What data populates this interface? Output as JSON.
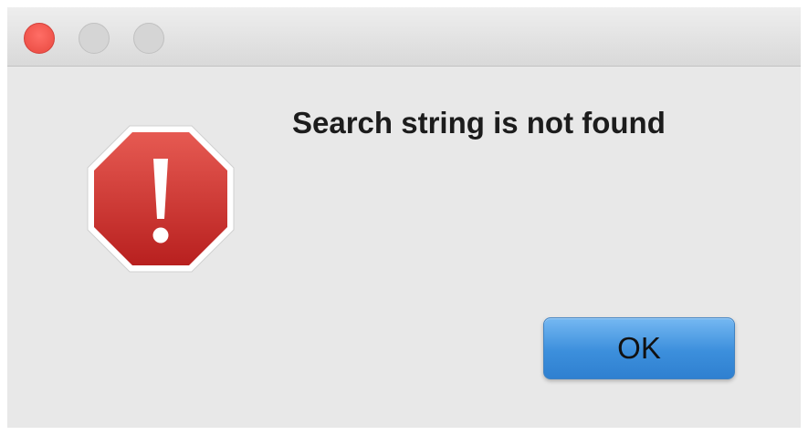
{
  "window": {
    "controls": [
      {
        "name": "close",
        "color": "#ed5a52"
      },
      {
        "name": "minimize",
        "color": "#d5d5d5"
      },
      {
        "name": "zoom",
        "color": "#d5d5d5"
      }
    ]
  },
  "alert": {
    "icon": "stop-exclamation-icon",
    "icon_color": "#c62a2a",
    "message": "Search string is not found"
  },
  "buttons": {
    "ok_label": "OK",
    "ok_color": "#3c8fdc"
  }
}
